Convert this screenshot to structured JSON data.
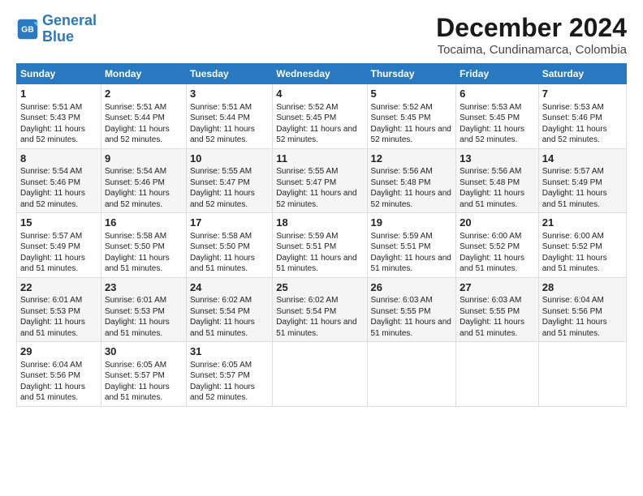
{
  "logo": {
    "line1": "General",
    "line2": "Blue"
  },
  "title": "December 2024",
  "subtitle": "Tocaima, Cundinamarca, Colombia",
  "headers": [
    "Sunday",
    "Monday",
    "Tuesday",
    "Wednesday",
    "Thursday",
    "Friday",
    "Saturday"
  ],
  "weeks": [
    [
      {
        "day": "1",
        "sunrise": "5:51 AM",
        "sunset": "5:43 PM",
        "daylight": "11 hours and 52 minutes."
      },
      {
        "day": "2",
        "sunrise": "5:51 AM",
        "sunset": "5:44 PM",
        "daylight": "11 hours and 52 minutes."
      },
      {
        "day": "3",
        "sunrise": "5:51 AM",
        "sunset": "5:44 PM",
        "daylight": "11 hours and 52 minutes."
      },
      {
        "day": "4",
        "sunrise": "5:52 AM",
        "sunset": "5:45 PM",
        "daylight": "11 hours and 52 minutes."
      },
      {
        "day": "5",
        "sunrise": "5:52 AM",
        "sunset": "5:45 PM",
        "daylight": "11 hours and 52 minutes."
      },
      {
        "day": "6",
        "sunrise": "5:53 AM",
        "sunset": "5:45 PM",
        "daylight": "11 hours and 52 minutes."
      },
      {
        "day": "7",
        "sunrise": "5:53 AM",
        "sunset": "5:46 PM",
        "daylight": "11 hours and 52 minutes."
      }
    ],
    [
      {
        "day": "8",
        "sunrise": "5:54 AM",
        "sunset": "5:46 PM",
        "daylight": "11 hours and 52 minutes."
      },
      {
        "day": "9",
        "sunrise": "5:54 AM",
        "sunset": "5:46 PM",
        "daylight": "11 hours and 52 minutes."
      },
      {
        "day": "10",
        "sunrise": "5:55 AM",
        "sunset": "5:47 PM",
        "daylight": "11 hours and 52 minutes."
      },
      {
        "day": "11",
        "sunrise": "5:55 AM",
        "sunset": "5:47 PM",
        "daylight": "11 hours and 52 minutes."
      },
      {
        "day": "12",
        "sunrise": "5:56 AM",
        "sunset": "5:48 PM",
        "daylight": "11 hours and 52 minutes."
      },
      {
        "day": "13",
        "sunrise": "5:56 AM",
        "sunset": "5:48 PM",
        "daylight": "11 hours and 51 minutes."
      },
      {
        "day": "14",
        "sunrise": "5:57 AM",
        "sunset": "5:49 PM",
        "daylight": "11 hours and 51 minutes."
      }
    ],
    [
      {
        "day": "15",
        "sunrise": "5:57 AM",
        "sunset": "5:49 PM",
        "daylight": "11 hours and 51 minutes."
      },
      {
        "day": "16",
        "sunrise": "5:58 AM",
        "sunset": "5:50 PM",
        "daylight": "11 hours and 51 minutes."
      },
      {
        "day": "17",
        "sunrise": "5:58 AM",
        "sunset": "5:50 PM",
        "daylight": "11 hours and 51 minutes."
      },
      {
        "day": "18",
        "sunrise": "5:59 AM",
        "sunset": "5:51 PM",
        "daylight": "11 hours and 51 minutes."
      },
      {
        "day": "19",
        "sunrise": "5:59 AM",
        "sunset": "5:51 PM",
        "daylight": "11 hours and 51 minutes."
      },
      {
        "day": "20",
        "sunrise": "6:00 AM",
        "sunset": "5:52 PM",
        "daylight": "11 hours and 51 minutes."
      },
      {
        "day": "21",
        "sunrise": "6:00 AM",
        "sunset": "5:52 PM",
        "daylight": "11 hours and 51 minutes."
      }
    ],
    [
      {
        "day": "22",
        "sunrise": "6:01 AM",
        "sunset": "5:53 PM",
        "daylight": "11 hours and 51 minutes."
      },
      {
        "day": "23",
        "sunrise": "6:01 AM",
        "sunset": "5:53 PM",
        "daylight": "11 hours and 51 minutes."
      },
      {
        "day": "24",
        "sunrise": "6:02 AM",
        "sunset": "5:54 PM",
        "daylight": "11 hours and 51 minutes."
      },
      {
        "day": "25",
        "sunrise": "6:02 AM",
        "sunset": "5:54 PM",
        "daylight": "11 hours and 51 minutes."
      },
      {
        "day": "26",
        "sunrise": "6:03 AM",
        "sunset": "5:55 PM",
        "daylight": "11 hours and 51 minutes."
      },
      {
        "day": "27",
        "sunrise": "6:03 AM",
        "sunset": "5:55 PM",
        "daylight": "11 hours and 51 minutes."
      },
      {
        "day": "28",
        "sunrise": "6:04 AM",
        "sunset": "5:56 PM",
        "daylight": "11 hours and 51 minutes."
      }
    ],
    [
      {
        "day": "29",
        "sunrise": "6:04 AM",
        "sunset": "5:56 PM",
        "daylight": "11 hours and 51 minutes."
      },
      {
        "day": "30",
        "sunrise": "6:05 AM",
        "sunset": "5:57 PM",
        "daylight": "11 hours and 51 minutes."
      },
      {
        "day": "31",
        "sunrise": "6:05 AM",
        "sunset": "5:57 PM",
        "daylight": "11 hours and 52 minutes."
      },
      null,
      null,
      null,
      null
    ]
  ],
  "labels": {
    "sunrise": "Sunrise:",
    "sunset": "Sunset:",
    "daylight": "Daylight:"
  }
}
